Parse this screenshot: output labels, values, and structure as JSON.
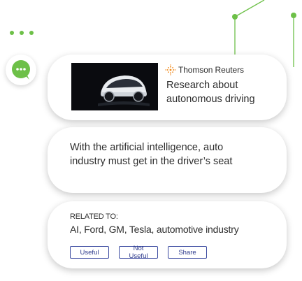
{
  "colors": {
    "accent_green": "#6dc048",
    "button_blue": "#3b4aa0",
    "text": "#2d2d2d"
  },
  "app": {
    "badge_icon": "chat-bubble-icon",
    "menu_icon": "more-dots-icon"
  },
  "article": {
    "source_icon": "thomson-reuters-logo",
    "source": "Thomson Reuters",
    "headline_line1": "Research about",
    "headline_line2": "autonomous driving"
  },
  "quote": {
    "line1": "With the artificial intelligence, auto",
    "line2": "industry must get in the driver’s seat"
  },
  "related": {
    "label": "RELATED TO:",
    "tags": "AI, Ford, GM, Tesla, automotive industry"
  },
  "actions": {
    "useful": "Useful",
    "not_useful": "Not Useful",
    "share": "Share"
  }
}
